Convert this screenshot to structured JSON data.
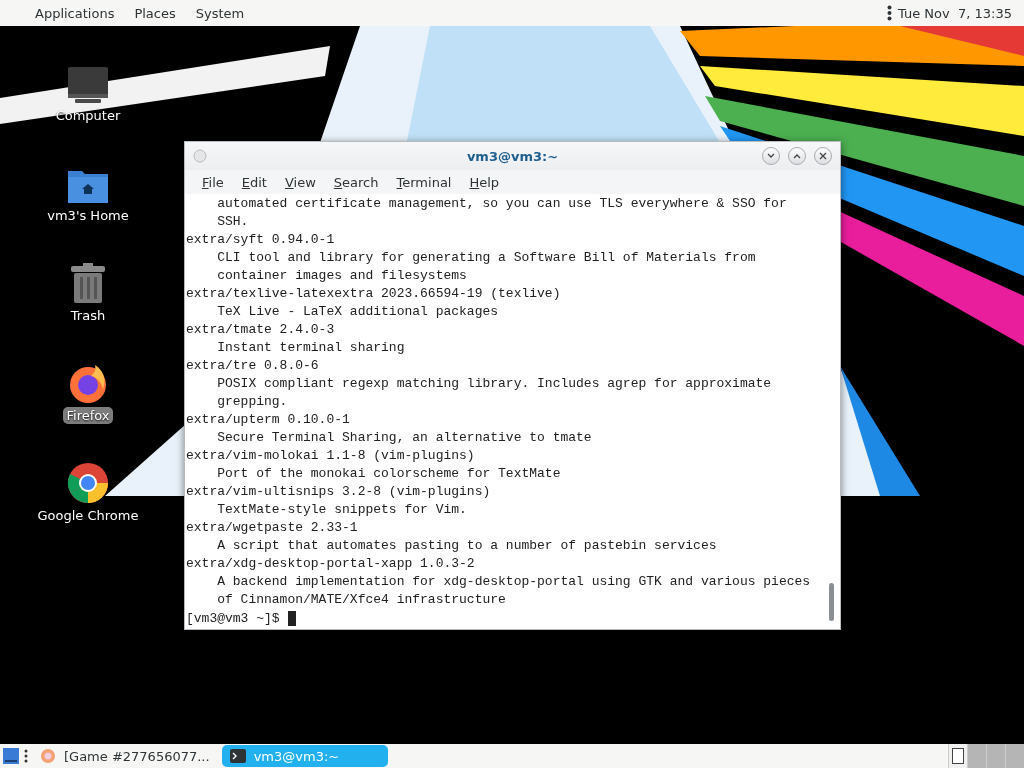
{
  "top_panel": {
    "menus": [
      "Applications",
      "Places",
      "System"
    ],
    "clock": "Tue Nov  7, 13:35"
  },
  "desktop_icons": [
    {
      "kind": "computer",
      "label": "Computer",
      "selected": false
    },
    {
      "kind": "home",
      "label": "vm3's Home",
      "selected": false
    },
    {
      "kind": "trash",
      "label": "Trash",
      "selected": false
    },
    {
      "kind": "firefox",
      "label": "Firefox",
      "selected": true
    },
    {
      "kind": "chrome",
      "label": "Google Chrome",
      "selected": false
    }
  ],
  "terminal": {
    "title": "vm3@vm3:~",
    "menus": [
      "File",
      "Edit",
      "View",
      "Search",
      "Terminal",
      "Help"
    ],
    "lines": [
      "    automated certificate management, so you can use TLS everywhere & SSO for",
      "    SSH.",
      "extra/syft 0.94.0-1",
      "    CLI tool and library for generating a Software Bill of Materials from",
      "    container images and filesystems",
      "extra/texlive-latexextra 2023.66594-19 (texlive)",
      "    TeX Live - LaTeX additional packages",
      "extra/tmate 2.4.0-3",
      "    Instant terminal sharing",
      "extra/tre 0.8.0-6",
      "    POSIX compliant regexp matching library. Includes agrep for approximate",
      "    grepping.",
      "extra/upterm 0.10.0-1",
      "    Secure Terminal Sharing, an alternative to tmate",
      "extra/vim-molokai 1.1-8 (vim-plugins)",
      "    Port of the monokai colorscheme for TextMate",
      "extra/vim-ultisnips 3.2-8 (vim-plugins)",
      "    TextMate-style snippets for Vim.",
      "extra/wgetpaste 2.33-1",
      "    A script that automates pasting to a number of pastebin services",
      "extra/xdg-desktop-portal-xapp 1.0.3-2",
      "    A backend implementation for xdg-desktop-portal using GTK and various pieces",
      "    of Cinnamon/MATE/Xfce4 infrastructure"
    ],
    "prompt": "[vm3@vm3 ~]$"
  },
  "taskbar": {
    "tasks": [
      {
        "kind": "browser",
        "label": "[Game #277656077...",
        "selected": false
      },
      {
        "kind": "terminal",
        "label": "vm3@vm3:~",
        "selected": true
      }
    ]
  }
}
